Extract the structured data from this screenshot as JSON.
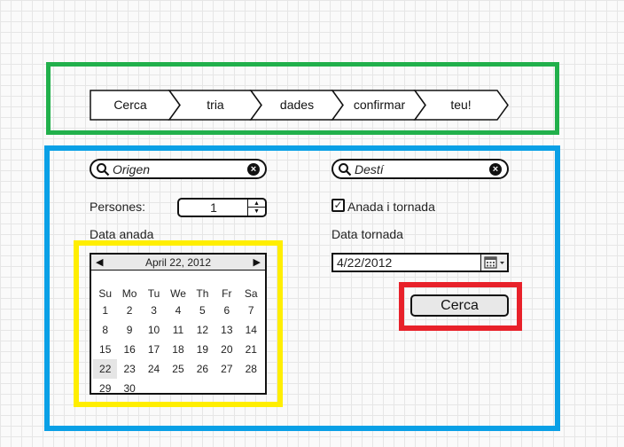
{
  "steps": [
    "Cerca",
    "tria",
    "dades",
    "confirmar",
    "teu!"
  ],
  "origin": {
    "placeholder": "Origen"
  },
  "destination": {
    "placeholder": "Destí"
  },
  "passengers": {
    "label": "Persones:",
    "value": "1"
  },
  "round_trip": {
    "label": "Anada i tornada",
    "checked": true
  },
  "departure": {
    "label": "Data anada",
    "calendar": {
      "month_label": "April 22, 2012",
      "weekdays": [
        "Su",
        "Mo",
        "Tu",
        "We",
        "Th",
        "Fr",
        "Sa"
      ],
      "weeks": [
        [
          "1",
          "2",
          "3",
          "4",
          "5",
          "6",
          "7"
        ],
        [
          "8",
          "9",
          "10",
          "11",
          "12",
          "13",
          "14"
        ],
        [
          "15",
          "16",
          "17",
          "18",
          "19",
          "20",
          "21"
        ],
        [
          "22",
          "23",
          "24",
          "25",
          "26",
          "27",
          "28"
        ],
        [
          "29",
          "30",
          "",
          "",
          "",
          "",
          ""
        ]
      ],
      "selected": "22"
    }
  },
  "return": {
    "label": "Data tornada",
    "value": "4/22/2012"
  },
  "search_button": {
    "label": "Cerca"
  },
  "colors": {
    "steps_frame": "#21b04b",
    "form_frame": "#0aa0e6",
    "calendar_frame": "#ffee00",
    "button_frame": "#e8212a"
  }
}
